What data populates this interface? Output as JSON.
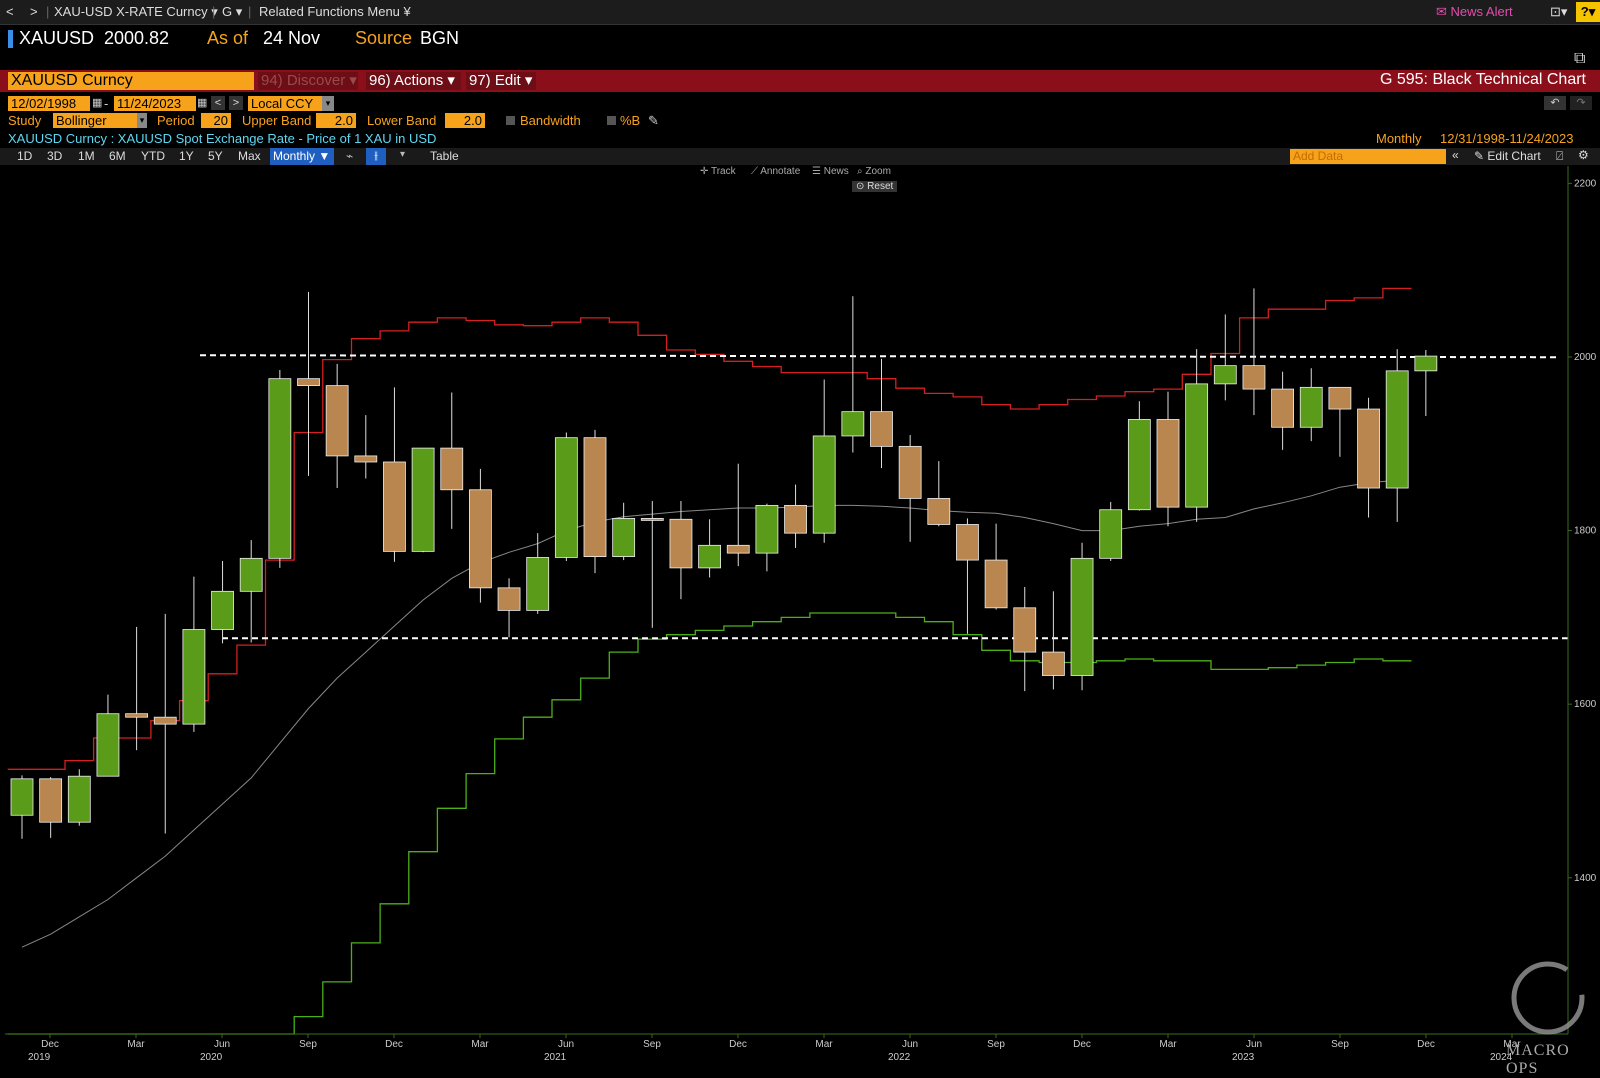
{
  "topbar": {
    "nav_back": "<",
    "nav_fwd": ">",
    "security": "XAU-USD X-RATE Curncy",
    "fn": "G",
    "related": "Related Functions Menu",
    "news_alert": "News Alert",
    "help": "?"
  },
  "ticker": {
    "symbol": "XAUUSD",
    "price": "2000.82",
    "as_of_label": "As of",
    "as_of_date": "24 Nov",
    "source_label": "Source",
    "source": "BGN"
  },
  "redbar": {
    "security": "XAUUSD Curncy",
    "discover": "94) Discover",
    "actions": "96) Actions",
    "edit": "97) Edit",
    "title": "G 595: Black Technical Chart"
  },
  "dates": {
    "start": "12/02/1998",
    "end": "11/24/2023",
    "currency": "Local CCY"
  },
  "study": {
    "label": "Study",
    "value": "Bollinger",
    "period_label": "Period",
    "period": "20",
    "upper_label": "Upper Band",
    "upper": "2.0",
    "lower_label": "Lower Band",
    "lower": "2.0",
    "bandwidth": "Bandwidth",
    "pctb": "%B"
  },
  "desc": {
    "text": "XAUUSD Curncy : XAUUSD Spot Exchange Rate - Price of 1 XAU in USD",
    "freq": "Monthly",
    "range": "12/31/1998-11/24/2023"
  },
  "range_buttons": [
    "1D",
    "3D",
    "1M",
    "6M",
    "YTD",
    "1Y",
    "5Y",
    "Max"
  ],
  "periodicity": "Monthly",
  "table_label": "Table",
  "add_data_placeholder": "Add Data",
  "edit_chart": "Edit Chart",
  "chart_tools": {
    "track": "Track",
    "annotate": "Annotate",
    "news": "News",
    "zoom": "Zoom",
    "reset": "Reset"
  },
  "watermark": "MACRO OPS",
  "colors": {
    "up": "#5a9c1a",
    "down": "#b8864e",
    "upper_band": "#d42020",
    "lower_band": "#4caf1a",
    "mid_band": "#888888",
    "accent": "#f7a21b",
    "redbar": "#8b0f1b"
  },
  "chart_data": {
    "type": "candlestick",
    "title": "XAUUSD Curncy : XAUUSD Spot Exchange Rate - Price of 1 XAU in USD",
    "periodicity": "Monthly",
    "ylim": [
      1220,
      2220
    ],
    "y_ticks": [
      1400,
      1600,
      1800,
      2000,
      2200
    ],
    "x_ticks": [
      {
        "label": "Dec",
        "year": "2019"
      },
      {
        "label": "Mar",
        "year": ""
      },
      {
        "label": "Jun",
        "year": "2020"
      },
      {
        "label": "Sep",
        "year": ""
      },
      {
        "label": "Dec",
        "year": ""
      },
      {
        "label": "Mar",
        "year": ""
      },
      {
        "label": "Jun",
        "year": "2021"
      },
      {
        "label": "Sep",
        "year": ""
      },
      {
        "label": "Dec",
        "year": ""
      },
      {
        "label": "Mar",
        "year": ""
      },
      {
        "label": "Jun",
        "year": "2022"
      },
      {
        "label": "Sep",
        "year": ""
      },
      {
        "label": "Dec",
        "year": ""
      },
      {
        "label": "Mar",
        "year": ""
      },
      {
        "label": "Jun",
        "year": "2023"
      },
      {
        "label": "Sep",
        "year": ""
      },
      {
        "label": "Dec",
        "year": ""
      },
      {
        "label": "Mar",
        "year": "2024"
      }
    ],
    "horizontal_lines": [
      {
        "value": 2002,
        "style": "dashed"
      },
      {
        "value": 1676,
        "style": "dashed"
      }
    ],
    "candles": [
      {
        "date": "2019-10",
        "open": 1472,
        "high": 1518,
        "low": 1445,
        "close": 1514
      },
      {
        "date": "2019-11",
        "open": 1514,
        "high": 1516,
        "low": 1446,
        "close": 1464
      },
      {
        "date": "2019-12",
        "open": 1464,
        "high": 1525,
        "low": 1460,
        "close": 1517
      },
      {
        "date": "2020-01",
        "open": 1517,
        "high": 1611,
        "low": 1517,
        "close": 1589
      },
      {
        "date": "2020-02",
        "open": 1589,
        "high": 1689,
        "low": 1547,
        "close": 1585
      },
      {
        "date": "2020-03",
        "open": 1585,
        "high": 1704,
        "low": 1451,
        "close": 1577
      },
      {
        "date": "2020-04",
        "open": 1577,
        "high": 1747,
        "low": 1568,
        "close": 1686
      },
      {
        "date": "2020-05",
        "open": 1686,
        "high": 1765,
        "low": 1670,
        "close": 1730
      },
      {
        "date": "2020-06",
        "open": 1730,
        "high": 1789,
        "low": 1671,
        "close": 1768
      },
      {
        "date": "2020-07",
        "open": 1768,
        "high": 1985,
        "low": 1757,
        "close": 1975
      },
      {
        "date": "2020-08",
        "open": 1975,
        "high": 2075,
        "low": 1863,
        "close": 1967
      },
      {
        "date": "2020-09",
        "open": 1967,
        "high": 1992,
        "low": 1849,
        "close": 1886
      },
      {
        "date": "2020-10",
        "open": 1886,
        "high": 1933,
        "low": 1860,
        "close": 1879
      },
      {
        "date": "2020-11",
        "open": 1879,
        "high": 1965,
        "low": 1764,
        "close": 1776
      },
      {
        "date": "2020-12",
        "open": 1776,
        "high": 1875,
        "low": 1775,
        "close": 1895
      },
      {
        "date": "2021-01",
        "open": 1895,
        "high": 1959,
        "low": 1802,
        "close": 1847
      },
      {
        "date": "2021-02",
        "open": 1847,
        "high": 1871,
        "low": 1717,
        "close": 1734
      },
      {
        "date": "2021-03",
        "open": 1734,
        "high": 1745,
        "low": 1677,
        "close": 1708
      },
      {
        "date": "2021-04",
        "open": 1708,
        "high": 1797,
        "low": 1704,
        "close": 1769
      },
      {
        "date": "2021-05",
        "open": 1769,
        "high": 1913,
        "low": 1765,
        "close": 1907
      },
      {
        "date": "2021-06",
        "open": 1907,
        "high": 1916,
        "low": 1751,
        "close": 1770
      },
      {
        "date": "2021-07",
        "open": 1770,
        "high": 1832,
        "low": 1766,
        "close": 1814
      },
      {
        "date": "2021-08",
        "open": 1814,
        "high": 1834,
        "low": 1688,
        "close": 1813
      },
      {
        "date": "2021-09",
        "open": 1813,
        "high": 1834,
        "low": 1721,
        "close": 1757
      },
      {
        "date": "2021-10",
        "open": 1757,
        "high": 1813,
        "low": 1746,
        "close": 1783
      },
      {
        "date": "2021-11",
        "open": 1783,
        "high": 1877,
        "low": 1759,
        "close": 1774
      },
      {
        "date": "2021-12",
        "open": 1774,
        "high": 1831,
        "low": 1753,
        "close": 1829
      },
      {
        "date": "2022-01",
        "open": 1829,
        "high": 1853,
        "low": 1780,
        "close": 1797
      },
      {
        "date": "2022-02",
        "open": 1797,
        "high": 1974,
        "low": 1786,
        "close": 1909
      },
      {
        "date": "2022-03",
        "open": 1909,
        "high": 2070,
        "low": 1890,
        "close": 1937
      },
      {
        "date": "2022-04",
        "open": 1937,
        "high": 1998,
        "low": 1872,
        "close": 1897
      },
      {
        "date": "2022-05",
        "open": 1897,
        "high": 1910,
        "low": 1787,
        "close": 1837
      },
      {
        "date": "2022-06",
        "open": 1837,
        "high": 1880,
        "low": 1805,
        "close": 1807
      },
      {
        "date": "2022-07",
        "open": 1807,
        "high": 1814,
        "low": 1681,
        "close": 1766
      },
      {
        "date": "2022-08",
        "open": 1766,
        "high": 1808,
        "low": 1709,
        "close": 1711
      },
      {
        "date": "2022-09",
        "open": 1711,
        "high": 1735,
        "low": 1615,
        "close": 1660
      },
      {
        "date": "2022-10",
        "open": 1660,
        "high": 1730,
        "low": 1617,
        "close": 1633
      },
      {
        "date": "2022-11",
        "open": 1633,
        "high": 1786,
        "low": 1616,
        "close": 1768
      },
      {
        "date": "2022-12",
        "open": 1768,
        "high": 1833,
        "low": 1765,
        "close": 1824
      },
      {
        "date": "2023-01",
        "open": 1824,
        "high": 1949,
        "low": 1823,
        "close": 1928
      },
      {
        "date": "2023-02",
        "open": 1928,
        "high": 1960,
        "low": 1805,
        "close": 1827
      },
      {
        "date": "2023-03",
        "open": 1827,
        "high": 2009,
        "low": 1810,
        "close": 1969
      },
      {
        "date": "2023-04",
        "open": 1969,
        "high": 2049,
        "low": 1950,
        "close": 1990
      },
      {
        "date": "2023-05",
        "open": 1990,
        "high": 2079,
        "low": 1933,
        "close": 1963
      },
      {
        "date": "2023-06",
        "open": 1963,
        "high": 1983,
        "low": 1893,
        "close": 1919
      },
      {
        "date": "2023-07",
        "open": 1919,
        "high": 1987,
        "low": 1903,
        "close": 1965
      },
      {
        "date": "2023-08",
        "open": 1965,
        "high": 1965,
        "low": 1885,
        "close": 1940
      },
      {
        "date": "2023-09",
        "open": 1940,
        "high": 1953,
        "low": 1815,
        "close": 1849
      },
      {
        "date": "2023-10",
        "open": 1849,
        "high": 2009,
        "low": 1810,
        "close": 1984
      },
      {
        "date": "2023-11",
        "open": 1984,
        "high": 2008,
        "low": 1932,
        "close": 2001
      }
    ],
    "bollinger_upper": [
      1525,
      1525,
      1535,
      1561,
      1561,
      1581,
      1604,
      1635,
      1668,
      1766,
      1913,
      1997,
      2021,
      2030,
      2040,
      2045,
      2042,
      2037,
      2036,
      2040,
      2045,
      2040,
      2025,
      2008,
      2003,
      1995,
      1989,
      1982,
      1982,
      1982,
      1975,
      1964,
      1958,
      1954,
      1945,
      1940,
      1945,
      1951,
      1955,
      1960,
      1963,
      1980,
      2004,
      2045,
      2055,
      2055,
      2065,
      2068,
      2079
    ],
    "bollinger_mid": [
      1320,
      1335,
      1355,
      1375,
      1400,
      1425,
      1455,
      1485,
      1515,
      1555,
      1595,
      1630,
      1660,
      1690,
      1720,
      1745,
      1763,
      1775,
      1785,
      1800,
      1810,
      1816,
      1819,
      1822,
      1824,
      1826,
      1826,
      1827,
      1829,
      1829,
      1828,
      1826,
      1823,
      1821,
      1820,
      1815,
      1808,
      1800,
      1800,
      1805,
      1808,
      1813,
      1815,
      1825,
      1832,
      1840,
      1850,
      1855,
      1858
    ],
    "bollinger_lower": [
      1150,
      1150,
      1140,
      1140,
      1140,
      1140,
      1140,
      1140,
      1140,
      1140,
      1240,
      1280,
      1325,
      1370,
      1430,
      1480,
      1520,
      1560,
      1585,
      1605,
      1630,
      1660,
      1675,
      1680,
      1685,
      1690,
      1695,
      1700,
      1705,
      1705,
      1705,
      1700,
      1695,
      1680,
      1662,
      1650,
      1648,
      1648,
      1650,
      1652,
      1650,
      1650,
      1640,
      1640,
      1642,
      1645,
      1648,
      1652,
      1650
    ]
  }
}
